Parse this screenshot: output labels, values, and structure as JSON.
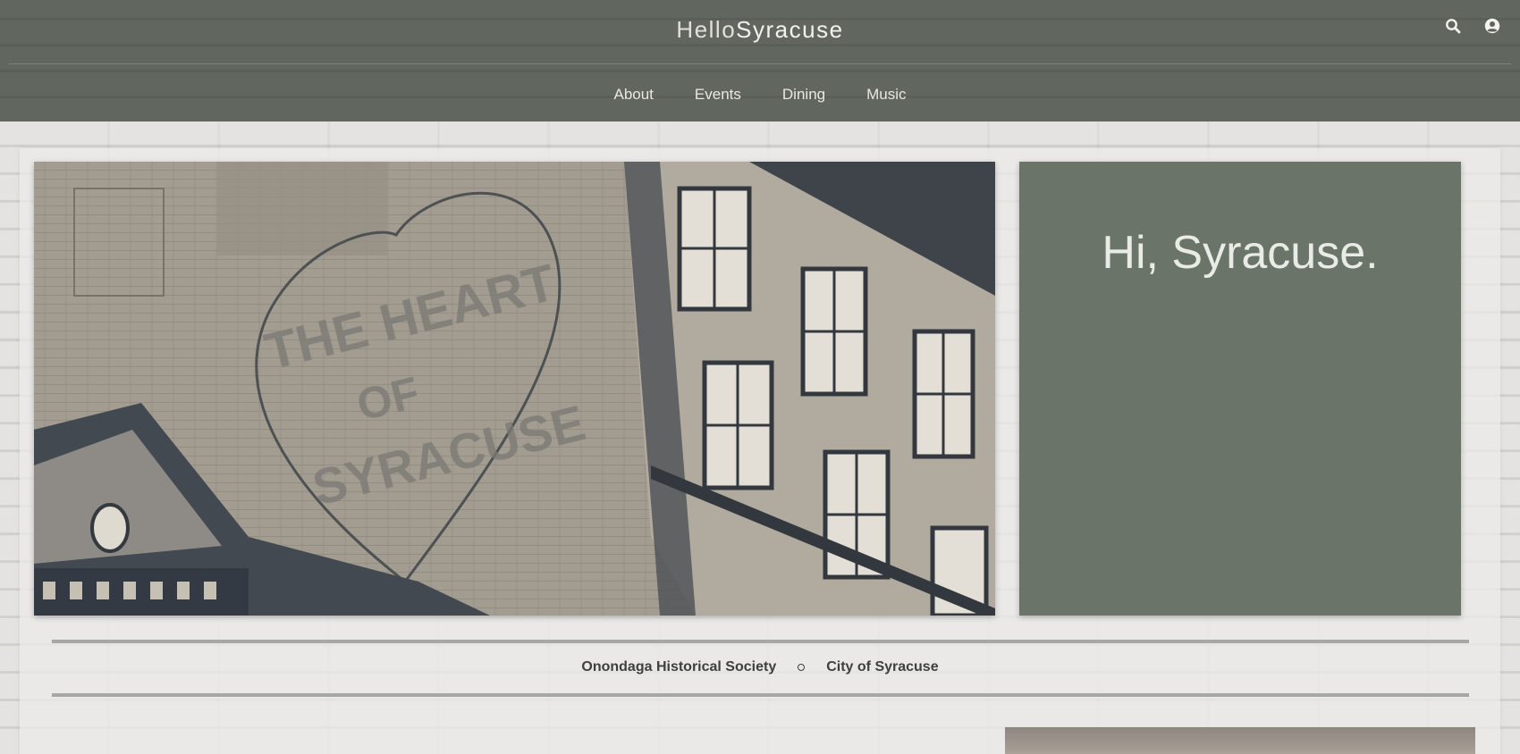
{
  "header": {
    "brand_light": "Hello",
    "brand_bold": "Syracuse",
    "icons": [
      "search-icon",
      "user-account-icon"
    ]
  },
  "nav": {
    "items": [
      {
        "label": "About"
      },
      {
        "label": "Events"
      },
      {
        "label": "Dining"
      },
      {
        "label": "Music"
      }
    ]
  },
  "hero": {
    "image": "photo of brick building with painted heart mural",
    "mural_text": [
      "THE HEART",
      "OF",
      "SYRACUSE"
    ]
  },
  "greeting": {
    "title": "Hi, Syracuse."
  },
  "partners": {
    "items": [
      {
        "label": "Onondaga Historical Society"
      },
      {
        "label": "City of Syracuse"
      }
    ]
  },
  "colors": {
    "header_bg": "#5e645c",
    "greeting_bg": "#6b7469",
    "page_bg": "#dcdbd8",
    "text_dark": "#3e403d",
    "text_light": "#e7e9e3"
  }
}
